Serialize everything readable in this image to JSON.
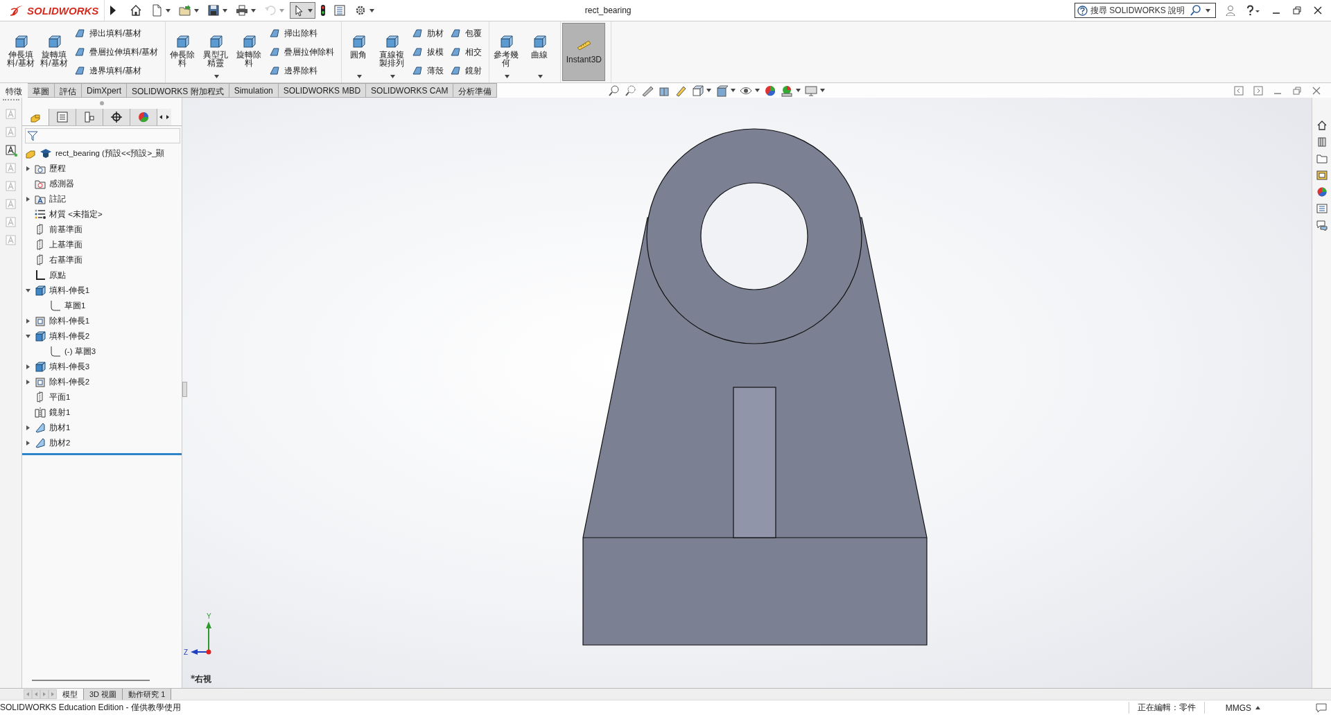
{
  "window": {
    "title": "rect_bearing"
  },
  "app_logo": {
    "text": "SOLIDWORKS"
  },
  "quick_access": [
    {
      "kind": "home",
      "dropdown": false,
      "selected": false,
      "disabled": false
    },
    {
      "kind": "new",
      "dropdown": true,
      "selected": false,
      "disabled": false
    },
    {
      "kind": "open",
      "dropdown": true,
      "selected": false,
      "disabled": false
    },
    {
      "kind": "save",
      "dropdown": true,
      "selected": false,
      "disabled": false
    },
    {
      "kind": "print",
      "dropdown": true,
      "selected": false,
      "disabled": false
    },
    {
      "kind": "undo",
      "dropdown": true,
      "selected": false,
      "disabled": true
    },
    {
      "kind": "select",
      "dropdown": true,
      "selected": true,
      "disabled": false
    },
    {
      "kind": "rebuild",
      "dropdown": false,
      "selected": false,
      "disabled": false
    },
    {
      "kind": "file-properties",
      "dropdown": false,
      "selected": false,
      "disabled": false
    },
    {
      "kind": "options",
      "dropdown": true,
      "selected": false,
      "disabled": false
    }
  ],
  "search": {
    "placeholder": "搜尋 SOLIDWORKS 說明"
  },
  "ribbon": {
    "groups": [
      {
        "items": [
          {
            "kind": "large",
            "label": "伸長填料/基材",
            "dropdown": false
          },
          {
            "kind": "large",
            "label": "旋轉填料/基材",
            "dropdown": false
          },
          {
            "kind": "small",
            "label": "掃出填料/基材"
          },
          {
            "kind": "small",
            "label": "疊層拉伸填料/基材"
          },
          {
            "kind": "small",
            "label": "邊界填料/基材"
          }
        ]
      },
      {
        "items": [
          {
            "kind": "large",
            "label": "伸長除料",
            "dropdown": false
          },
          {
            "kind": "large",
            "label": "異型孔精靈",
            "dropdown": true
          },
          {
            "kind": "large",
            "label": "旋轉除料",
            "dropdown": false
          },
          {
            "kind": "small",
            "label": "掃出除料"
          },
          {
            "kind": "small",
            "label": "疊層拉伸除料"
          },
          {
            "kind": "small",
            "label": "邊界除料"
          }
        ]
      },
      {
        "items": [
          {
            "kind": "large",
            "label": "圓角",
            "dropdown": true
          },
          {
            "kind": "large",
            "label": "直線複製排列",
            "dropdown": true
          },
          {
            "kind": "small",
            "label": "肋材"
          },
          {
            "kind": "small",
            "label": "拔模"
          },
          {
            "kind": "small",
            "label": "薄殼"
          },
          {
            "kind": "small",
            "label": "包覆"
          },
          {
            "kind": "small",
            "label": "相交"
          },
          {
            "kind": "small",
            "label": "鏡射"
          }
        ]
      },
      {
        "items": [
          {
            "kind": "large",
            "label": "參考幾何",
            "dropdown": true
          },
          {
            "kind": "large",
            "label": "曲線",
            "dropdown": true
          }
        ]
      },
      {
        "items": [
          {
            "kind": "toggle",
            "label": "Instant3D",
            "selected": true
          }
        ]
      }
    ]
  },
  "command_tabs": [
    {
      "label": "特徵",
      "selected": true
    },
    {
      "label": "草圖",
      "selected": false
    },
    {
      "label": "評估",
      "selected": false
    },
    {
      "label": "DimXpert",
      "selected": false
    },
    {
      "label": "SOLIDWORKS 附加程式",
      "selected": false
    },
    {
      "label": "Simulation",
      "selected": false
    },
    {
      "label": "SOLIDWORKS MBD",
      "selected": false
    },
    {
      "label": "SOLIDWORKS CAM",
      "selected": false
    },
    {
      "label": "分析準備",
      "selected": false
    }
  ],
  "feature_tree": {
    "root": {
      "label": "rect_bearing (預設<<預設>_顯"
    },
    "items": [
      {
        "kind": "history",
        "label": "歷程",
        "expanded": false
      },
      {
        "kind": "sensor",
        "label": "感測器"
      },
      {
        "kind": "annotation",
        "label": "註記",
        "expanded": false
      },
      {
        "kind": "material",
        "label": "材質 <未指定>"
      },
      {
        "kind": "plane",
        "label": "前基準面"
      },
      {
        "kind": "plane",
        "label": "上基準面"
      },
      {
        "kind": "plane",
        "label": "右基準面"
      },
      {
        "kind": "origin",
        "label": "原點"
      },
      {
        "kind": "boss",
        "label": "填料-伸長1",
        "expanded": true,
        "children": [
          {
            "kind": "sketch",
            "label": "草圖1"
          }
        ]
      },
      {
        "kind": "cut",
        "label": "除料-伸長1",
        "expanded": false
      },
      {
        "kind": "boss",
        "label": "填料-伸長2",
        "expanded": true,
        "children": [
          {
            "kind": "sketch",
            "label": "(-) 草圖3"
          }
        ]
      },
      {
        "kind": "boss",
        "label": "填料-伸長3",
        "expanded": false
      },
      {
        "kind": "cut",
        "label": "除料-伸長2",
        "expanded": false
      },
      {
        "kind": "plane",
        "label": "平面1"
      },
      {
        "kind": "mirror",
        "label": "鏡射1"
      },
      {
        "kind": "rib",
        "label": "肋材1",
        "expanded": false
      },
      {
        "kind": "rib",
        "label": "肋材2",
        "expanded": false
      }
    ]
  },
  "viewport": {
    "view_label": "*右視",
    "triad": {
      "y_label": "Y",
      "z_label": "Z"
    }
  },
  "bottom_tabs": [
    {
      "label": "模型",
      "selected": true
    },
    {
      "label": "3D 視圖",
      "selected": false
    },
    {
      "label": "動作研究 1",
      "selected": false
    }
  ],
  "status_bar": {
    "edition": "SOLIDWORKS Education Edition - 僅供教學使用",
    "editing": "正在編輯：零件",
    "units": "MMGS"
  }
}
